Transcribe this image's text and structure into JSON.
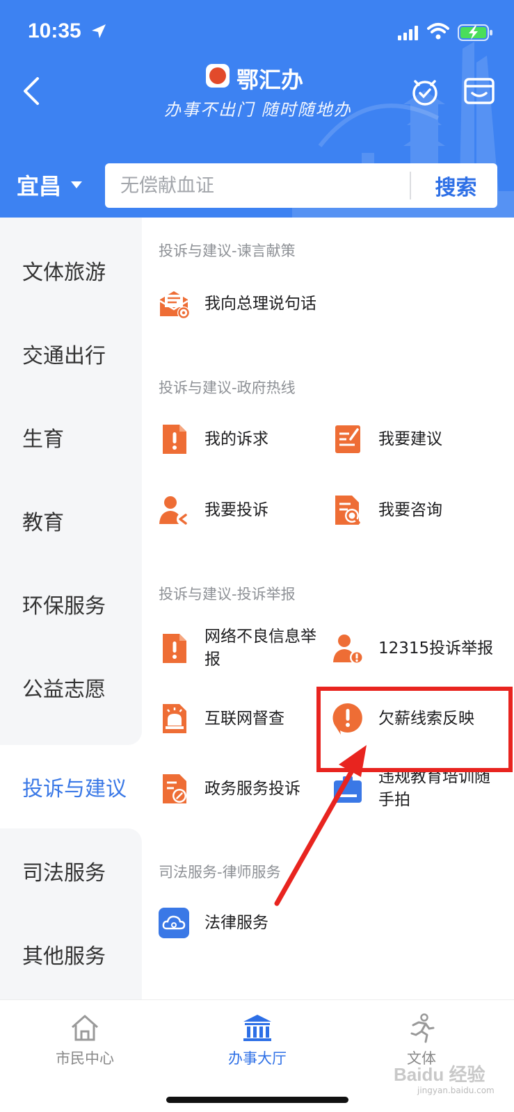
{
  "status_bar": {
    "time": "10:35"
  },
  "header": {
    "app_name": "鄂汇办",
    "slogan": "办事不出门 随时随地办"
  },
  "location": {
    "city": "宜昌"
  },
  "search": {
    "placeholder": "无偿献血证",
    "button_label": "搜索"
  },
  "sidebar": {
    "items": [
      {
        "label": "文体旅游"
      },
      {
        "label": "交通出行"
      },
      {
        "label": "生育"
      },
      {
        "label": "教育"
      },
      {
        "label": "环保服务"
      },
      {
        "label": "公益志愿"
      },
      {
        "label": "投诉与建议",
        "active": true
      },
      {
        "label": "司法服务"
      },
      {
        "label": "其他服务"
      }
    ]
  },
  "sections": [
    {
      "title": "投诉与建议-谏言献策",
      "items": [
        {
          "label": "我向总理说句话",
          "icon": "mail-at-icon"
        }
      ]
    },
    {
      "title": "投诉与建议-政府热线",
      "items": [
        {
          "label": "我的诉求",
          "icon": "doc-alert-icon"
        },
        {
          "label": "我要建议",
          "icon": "doc-edit-icon"
        },
        {
          "label": "我要投诉",
          "icon": "person-complaint-icon"
        },
        {
          "label": "我要咨询",
          "icon": "doc-search-icon"
        }
      ]
    },
    {
      "title": "投诉与建议-投诉举报",
      "items": [
        {
          "label": "网络不良信息举报",
          "icon": "doc-alert-icon"
        },
        {
          "label": "12315投诉举报",
          "icon": "person-alert-icon"
        },
        {
          "label": "互联网督查",
          "icon": "doc-alarm-icon"
        },
        {
          "label": "欠薪线索反映",
          "icon": "alert-bubble-icon"
        },
        {
          "label": "政务服务投诉",
          "icon": "doc-pen-icon"
        },
        {
          "label": "违规教育培训随手拍",
          "icon": "camera-icon"
        }
      ]
    },
    {
      "title": "司法服务-律师服务",
      "items": [
        {
          "label": "法律服务",
          "icon": "cloud-service-icon"
        }
      ]
    }
  ],
  "tabbar": {
    "tabs": [
      {
        "label": "市民中心",
        "icon": "home-icon"
      },
      {
        "label": "办事大厅",
        "icon": "hall-icon",
        "active": true
      },
      {
        "label": "文体",
        "icon": "runner-icon"
      }
    ]
  },
  "watermark": {
    "text": "Baidu 经验",
    "sub": "jingyan.baidu.com"
  },
  "colors": {
    "header_blue": "#3d82f2",
    "accent_blue": "#2d6fe6",
    "icon_orange": "#ee6d35",
    "highlight_red": "#e8241f"
  }
}
